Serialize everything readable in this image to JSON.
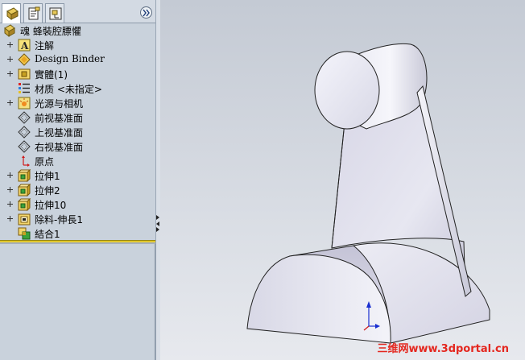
{
  "panel": {
    "tabs": [
      {
        "name": "feature-manager",
        "active": true
      },
      {
        "name": "property-manager",
        "active": false
      },
      {
        "name": "configuration-manager",
        "active": false
      }
    ],
    "expand_icon": "double-chevron-right-icon"
  },
  "tree": {
    "root": {
      "label": "魂 蜂裝腔膘懼",
      "icon": "part-icon"
    },
    "items": [
      {
        "label": "注解",
        "icon": "annotations-icon",
        "expandable": true
      },
      {
        "label": "Design Binder",
        "icon": "design-binder-icon",
        "expandable": true
      },
      {
        "label": "實體(1)",
        "icon": "solid-bodies-icon",
        "expandable": true
      },
      {
        "label": "材质 <未指定>",
        "icon": "material-icon",
        "expandable": false
      },
      {
        "label": "光源与相机",
        "icon": "lights-cameras-icon",
        "expandable": true
      },
      {
        "label": "前视基准面",
        "icon": "plane-icon",
        "expandable": false
      },
      {
        "label": "上视基准面",
        "icon": "plane-icon",
        "expandable": false
      },
      {
        "label": "右视基准面",
        "icon": "plane-icon",
        "expandable": false
      },
      {
        "label": "原点",
        "icon": "origin-icon",
        "expandable": false
      },
      {
        "label": "拉伸1",
        "icon": "extrude-icon",
        "expandable": true
      },
      {
        "label": "拉伸2",
        "icon": "extrude-icon",
        "expandable": true
      },
      {
        "label": "拉伸10",
        "icon": "extrude-icon",
        "expandable": true
      },
      {
        "label": "除料-伸長1",
        "icon": "cut-extrude-icon",
        "expandable": true
      },
      {
        "label": "結合1",
        "icon": "combine-icon",
        "expandable": false
      }
    ]
  },
  "viewport": {
    "watermark": "三维网www.3dportal.cn"
  },
  "colors": {
    "rollback_bar": "#e2c82e",
    "watermark": "#e4271f",
    "panel_bg": "#c9d2dc"
  }
}
